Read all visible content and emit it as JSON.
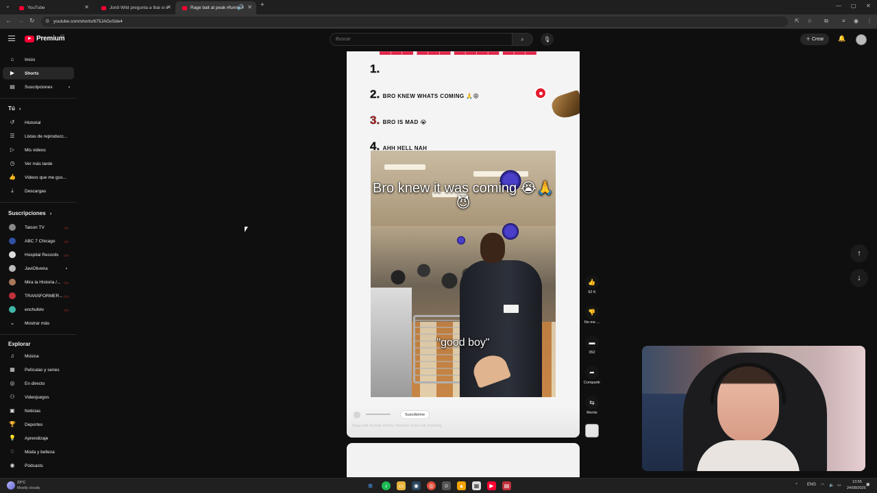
{
  "browser": {
    "tabs": [
      {
        "label": "YouTube",
        "active": false
      },
      {
        "label": "Jordi Wild pregunta a Ibai si e",
        "active": false
      },
      {
        "label": "Rage bait at peak #funny #",
        "active": true
      }
    ],
    "url": "youtube.com/shorts/675JAGoSde4"
  },
  "header": {
    "logo_text": "Premium",
    "logo_sup": "CO",
    "search_placeholder": "Buscar",
    "create_label": "Crear"
  },
  "sidebar": {
    "main": [
      {
        "label": "Inicio",
        "icon": "home-icon"
      },
      {
        "label": "Shorts",
        "icon": "shorts-icon",
        "active": true
      },
      {
        "label": "Suscripciones",
        "icon": "subscriptions-icon"
      }
    ],
    "you_heading": "Tú",
    "you": [
      {
        "label": "Historial",
        "icon": "history-icon"
      },
      {
        "label": "Listas de reproducc...",
        "icon": "playlists-icon"
      },
      {
        "label": "Mis videos",
        "icon": "my-videos-icon"
      },
      {
        "label": "Ver más tarde",
        "icon": "watch-later-icon"
      },
      {
        "label": "Videos que me gus...",
        "icon": "liked-icon"
      },
      {
        "label": "Descargas",
        "icon": "download-icon"
      }
    ],
    "subs_heading": "Suscripciones",
    "subs": [
      {
        "label": "Taison TV"
      },
      {
        "label": "ABC 7 Chicago"
      },
      {
        "label": "Hospital Records"
      },
      {
        "label": "JaviOliveira"
      },
      {
        "label": "Mira la Historia /..."
      },
      {
        "label": "TRANSFORMER..."
      },
      {
        "label": "enchufetv"
      }
    ],
    "show_more": "Mostrar más",
    "explore_heading": "Explorar",
    "explore": [
      {
        "label": "Música",
        "icon": "music-icon"
      },
      {
        "label": "Películas y series",
        "icon": "movies-icon"
      },
      {
        "label": "En directo",
        "icon": "live-icon"
      },
      {
        "label": "Videojuegos",
        "icon": "gaming-icon"
      },
      {
        "label": "Noticias",
        "icon": "news-icon"
      },
      {
        "label": "Deportes",
        "icon": "sports-icon"
      },
      {
        "label": "Aprendizaje",
        "icon": "learning-icon"
      },
      {
        "label": "Moda y belleza",
        "icon": "fashion-icon"
      },
      {
        "label": "Pódcasts",
        "icon": "podcasts-icon"
      }
    ]
  },
  "short": {
    "meme_list": [
      {
        "num": "1.",
        "text": ""
      },
      {
        "num": "2.",
        "text": "BRO KNEW WHATS COMING 🙏😩"
      },
      {
        "num": "3.",
        "text": "BRO IS MAD 😭"
      },
      {
        "num": "4.",
        "text": "AHH HELL NAH"
      }
    ],
    "video_caption_top": "Bro knew it was coming 😭🙏😈",
    "video_caption_bottom": "\"good boy\"",
    "subscribe_label": "Suscribirme",
    "title": "Rage bait at peak #funny #memes #usa #uk #ranking"
  },
  "actions": {
    "like_count": "62 K",
    "dislike_label": "No me ...",
    "comments_count": "352",
    "share_label": "Compartir",
    "remix_label": "Remix"
  },
  "taskbar": {
    "temp": "23°C",
    "weather": "Mostly cloudy",
    "lang": "ENG",
    "time": "13:55",
    "date": "24/08/2025"
  }
}
